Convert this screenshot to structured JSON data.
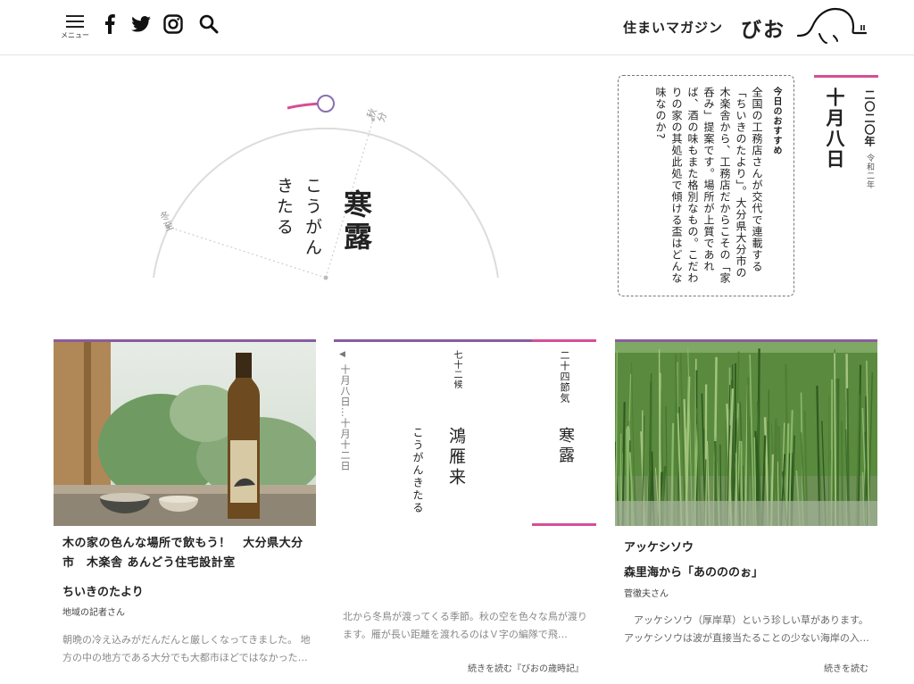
{
  "header": {
    "menu_label": "メニュー",
    "brand_sub": "住まいマガジン",
    "brand_main": "びお",
    "icons": [
      "menu-icon",
      "facebook-icon",
      "twitter-icon",
      "instagram-icon",
      "search-icon",
      "bio-logo"
    ]
  },
  "hero": {
    "title": "寒露",
    "reading": "こうがん\nきたる",
    "label_autumn": "秋分",
    "label_winter": "冬至"
  },
  "date": {
    "year": "二〇二〇年",
    "era": "令和二年",
    "day": "十月八日"
  },
  "recommend": {
    "heading": "今日のおすすめ",
    "text": "全国の工務店さんが交代で連載する「ちいきのたより」。大分県大分市の木楽舎から、工務店だからこその「家呑み」提案です。場所が上質であれば、酒の味もまた格別なもの。こだわりの家の其処此処で傾ける盃はどんな味なのか?"
  },
  "card1": {
    "title": "木の家の色んな場所で飲もう！　大分県大分市　木楽舎 あんどう住宅設計室",
    "subtitle": "ちいきのたより",
    "author": "地域の記者さん",
    "excerpt": "朝晩の冷え込みがだんだんと厳しくなってきました。 地方の中の地方である大分でも大都市ほどではなかった…"
  },
  "card2": {
    "sekki_label": "二十四節気",
    "sekki_name": "寒露",
    "kou_label": "七十二候",
    "kou_name": "鴻雁来",
    "kou_reading": "こうがんきたる",
    "period": "十月八日…十月十二日",
    "excerpt": "北から冬鳥が渡ってくる季節。秋の空を色々な鳥が渡ります。雁が長い距離を渡れるのはＶ字の編隊で飛…",
    "more": "続きを読む『びおの歳時記』"
  },
  "card3": {
    "title": "アッケシソウ",
    "subtitle": "森里海から「あのののぉ」",
    "author": "菅徹夫さん",
    "excerpt": "　アッケシソウ（厚岸草）という珍しい草があります。アッケシソウは波が直接当たることの少ない海岸の入…",
    "more": "続きを読む"
  },
  "colors": {
    "accent_pink": "#d64f96",
    "accent_purple": "#8a5c9e",
    "marker_ring": "#8a6fb0"
  }
}
